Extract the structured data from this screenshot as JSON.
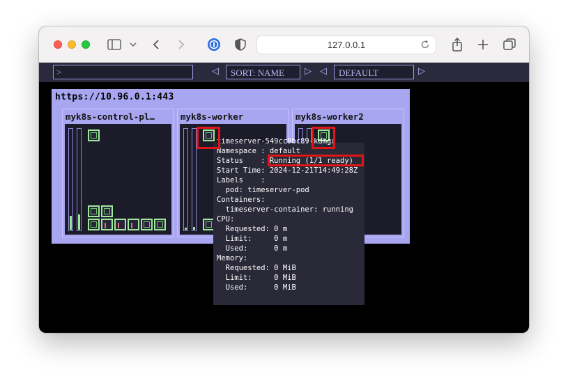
{
  "browser": {
    "address": "127.0.0.1",
    "icons": [
      "sidebar-icon",
      "chevron-down-icon",
      "back-icon",
      "forward-icon",
      "password-icon",
      "shield-icon",
      "reload-icon",
      "share-icon",
      "new-tab-icon",
      "tabs-overview-icon"
    ]
  },
  "toolbar": {
    "filter_placeholder": ">",
    "sort_label": "SORT: NAME",
    "namespace_label": "DEFAULT",
    "prev_arrow": "◁",
    "next_arrow": "▷"
  },
  "cluster": {
    "url": "https://10.96.0.1:443",
    "nodes": [
      {
        "name": "myk8s-control-pl…"
      },
      {
        "name": "myk8s-worker"
      },
      {
        "name": "myk8s-worker2"
      }
    ]
  },
  "tooltip": {
    "pod_name": "timeserver-549cc9bc89-kdmgx",
    "namespace": "Namespace : default",
    "status_label": "Status    : ",
    "status_value": "Running (1/1 ready)",
    "start_time": "Start Time: 2024-12-21T14:49:28Z",
    "labels_header": "Labels    :",
    "label_pod": "  pod: timeserver-pod",
    "containers_header": "Containers:",
    "container": "  timeserver-container: running",
    "cpu_header": "CPU:",
    "cpu_requested": "  Requested: 0 m",
    "cpu_limit": "  Limit:     0 m",
    "cpu_used": "  Used:      0 m",
    "memory_header": "Memory:",
    "mem_requested": "  Requested: 0 MiB",
    "mem_limit": "  Limit:     0 MiB",
    "mem_used": "  Used:      0 MiB"
  },
  "colors": {
    "node_bg": "#a8a6f0",
    "pod_border": "#9fe79b",
    "highlight": "#e01616",
    "tooltip_bg": "#2a2938"
  }
}
